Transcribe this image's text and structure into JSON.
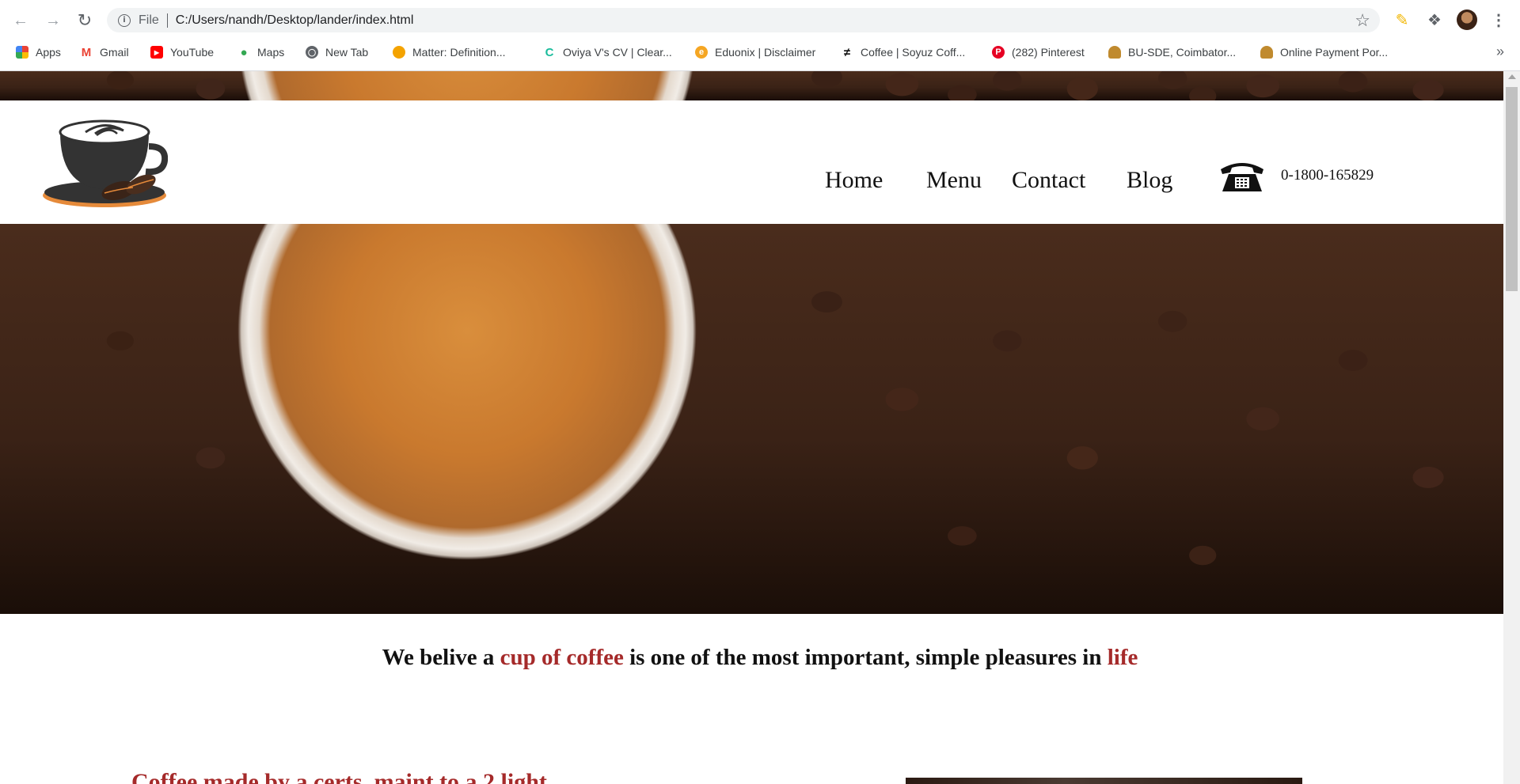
{
  "browser": {
    "omnibox": {
      "scheme_label": "File",
      "url": "C:/Users/nandh/Desktop/lander/index.html"
    },
    "bookmarks": [
      {
        "label": "Apps",
        "icon": "apps-grid-icon",
        "color": "#ea4335"
      },
      {
        "label": "Gmail",
        "icon": "gmail-icon",
        "color": "#ea4335"
      },
      {
        "label": "YouTube",
        "icon": "youtube-icon",
        "color": "#ff0000"
      },
      {
        "label": "Maps",
        "icon": "maps-pin-icon",
        "color": "#34a853"
      },
      {
        "label": "New Tab",
        "icon": "globe-icon",
        "color": "#5f6368"
      },
      {
        "label": "Matter: Definition...",
        "icon": "matter-site-icon",
        "color": "#f4a300"
      },
      {
        "label": "Oviya V's CV | Clear...",
        "icon": "cv-site-icon",
        "color": "#1abc9c"
      },
      {
        "label": "Eduonix | Disclaimer",
        "icon": "eduonix-icon",
        "color": "#f5a623"
      },
      {
        "label": "Coffee | Soyuz Coff...",
        "icon": "soyuz-coffee-icon",
        "color": "#111111"
      },
      {
        "label": "(282) Pinterest",
        "icon": "pinterest-icon",
        "color": "#e60023"
      },
      {
        "label": "BU-SDE, Coimbator...",
        "icon": "person-icon",
        "color": "#c08a2e"
      },
      {
        "label": "Online Payment Por...",
        "icon": "person-icon",
        "color": "#c08a2e"
      }
    ],
    "bookmarks_overflow": "»"
  },
  "site": {
    "nav": {
      "home": "Home",
      "menu": "Menu",
      "contact": "Contact",
      "blog": "Blog"
    },
    "phone": "0-1800-165829",
    "tagline": {
      "part1": "We belive a ",
      "accent1": "cup of coffee",
      "part2": " is one of the most important, simple pleasures in ",
      "accent2": "life"
    },
    "section_heading": "Coffee made by a certs, maint to a 2 light",
    "colors": {
      "accent": "#a52a2a",
      "text": "#111111"
    }
  }
}
